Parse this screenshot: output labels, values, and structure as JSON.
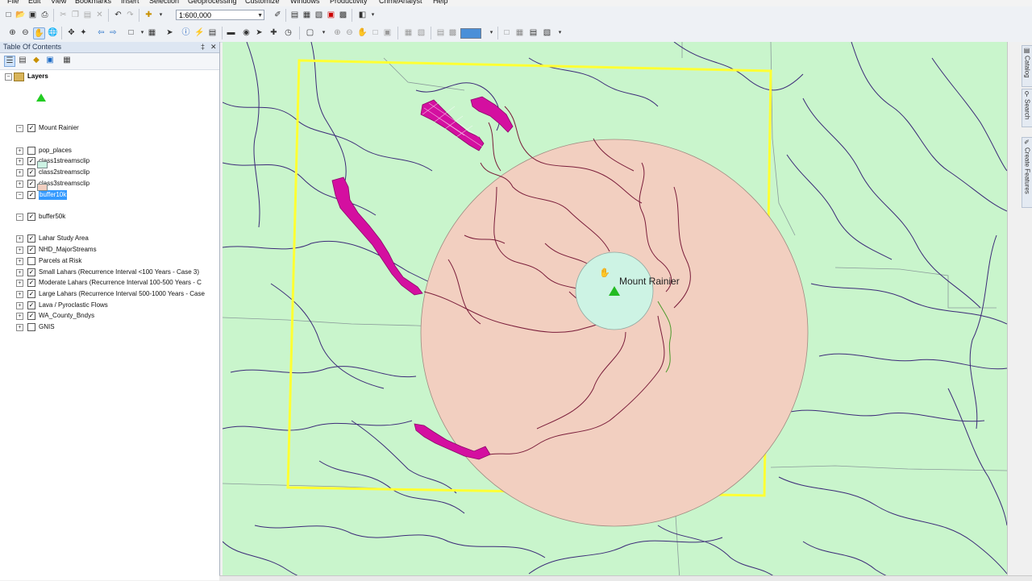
{
  "menu": [
    "File",
    "Edit",
    "View",
    "Bookmarks",
    "Insert",
    "Selection",
    "Geoprocessing",
    "Customize",
    "Windows",
    "Productivity",
    "CrimeAnalyst",
    "Help"
  ],
  "toolbar": {
    "scale": "1:600,000"
  },
  "toc": {
    "title": "Table Of Contents",
    "pin": "‡",
    "close": "✕",
    "root_label": "Layers",
    "layers": [
      {
        "label": "Mount Rainier",
        "checked": true,
        "expanded": true
      },
      {
        "label": "pop_places",
        "checked": false,
        "expanded": false
      },
      {
        "label": "class1streamsclip",
        "checked": true,
        "expanded": false
      },
      {
        "label": "class2streamsclip",
        "checked": true,
        "expanded": false
      },
      {
        "label": "class3streamsclip",
        "checked": true,
        "expanded": false
      },
      {
        "label": "buffer10k",
        "checked": true,
        "expanded": true,
        "selected": true
      },
      {
        "label": "buffer50k",
        "checked": true,
        "expanded": true
      },
      {
        "label": "Lahar Study Area",
        "checked": true,
        "expanded": false
      },
      {
        "label": "NHD_MajorStreams",
        "checked": true,
        "expanded": false
      },
      {
        "label": "Parcels at Risk",
        "checked": false,
        "expanded": false
      },
      {
        "label": "Small Lahars (Recurrence Interval <100 Years - Case 3)",
        "checked": true,
        "expanded": false
      },
      {
        "label": "Moderate Lahars (Recurrence Interval 100-500 Years - C",
        "checked": true,
        "expanded": false
      },
      {
        "label": "Large Lahars (Recurrence Interval 500-1000 Years - Case",
        "checked": true,
        "expanded": false
      },
      {
        "label": "Lava / Pyroclastic Flows",
        "checked": true,
        "expanded": false
      },
      {
        "label": "WA_County_Bndys",
        "checked": true,
        "expanded": false
      },
      {
        "label": "GNIS",
        "checked": false,
        "expanded": false
      }
    ]
  },
  "map": {
    "feature_label": "Mount Rainier",
    "colors": {
      "background": "#c9f5cc",
      "buffer50k": "#f2cfc0",
      "buffer10k": "#cdf3e4",
      "study_area": "#ffff33",
      "lahar": "#d40fa0",
      "streams": "#3c2a78",
      "peak": "#22bb22"
    }
  },
  "dock": {
    "tabs": [
      "Catalog",
      "Search",
      "Create Features"
    ]
  },
  "icons": {
    "checked": "✓",
    "minus": "−",
    "plus": "+"
  }
}
